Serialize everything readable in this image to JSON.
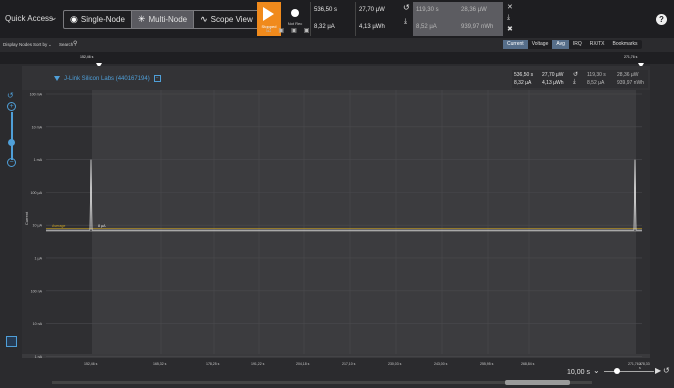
{
  "topbar": {
    "quick_access": "Quick Access",
    "modes": [
      {
        "label": "Single-Node",
        "icon": "circle-dot-icon",
        "active": false
      },
      {
        "label": "Multi-Node",
        "icon": "network-icon",
        "active": true
      },
      {
        "label": "Scope View",
        "icon": "waveform-icon",
        "active": false
      }
    ],
    "play_label": "Stopped",
    "rec_label": "Not Rec",
    "help": "?"
  },
  "stats_top": {
    "time1": "536,50 s",
    "power1": "27,70 µW",
    "current1": "8,32 µA",
    "energy1": "4,13 µWh",
    "time2": "119,30 s",
    "power2": "28,36 µW",
    "current2": "8,52 µA",
    "energy2": "939,97 nWh"
  },
  "subbar": {
    "display_nodes": "Display Nodes",
    "sort_by": "Sort by",
    "search": "Search",
    "tabs": [
      "Current",
      "Voltage",
      "Avg",
      "IRQ",
      "RX/TX",
      "Bookmarks"
    ],
    "active_tabs": [
      "Current",
      "Avg"
    ]
  },
  "timebar": {
    "left_marker": "152,46 s",
    "right_marker": "271,76 s"
  },
  "plot": {
    "device_name": "J-Link Silicon Labs (440167194)",
    "y_axis_title": "Current",
    "y_ticks": [
      "100 mA",
      "10 mA",
      "1 mA",
      "100 µA",
      "10 µA",
      "1 µA",
      "100 nA",
      "10 nA",
      "1 nA"
    ],
    "average_label": "Average",
    "average_value": "8 µA",
    "x_ticks": [
      "152,46 s",
      "165,32 s",
      "178,25 s",
      "191,22 s",
      "204,18 s",
      "217,10 s",
      "230,03 s",
      "243,00 s",
      "255,95 s",
      "268,84 s",
      "271,76 s",
      "278,33 s"
    ],
    "stats": {
      "time1": "536,50 s",
      "power1": "27,70 µW",
      "current1": "8,32 µA",
      "energy1": "4,13 µWh",
      "time2": "119,30 s",
      "power2": "28,36 µW",
      "current2": "8,52 µA",
      "energy2": "939,97 nWh"
    }
  },
  "bottombar": {
    "zoom_value": "10,00 s"
  },
  "colors": {
    "accent": "#4f9fd8",
    "play": "#f08a1c",
    "trace": "#e8e8e8",
    "average": "#c8a020"
  }
}
